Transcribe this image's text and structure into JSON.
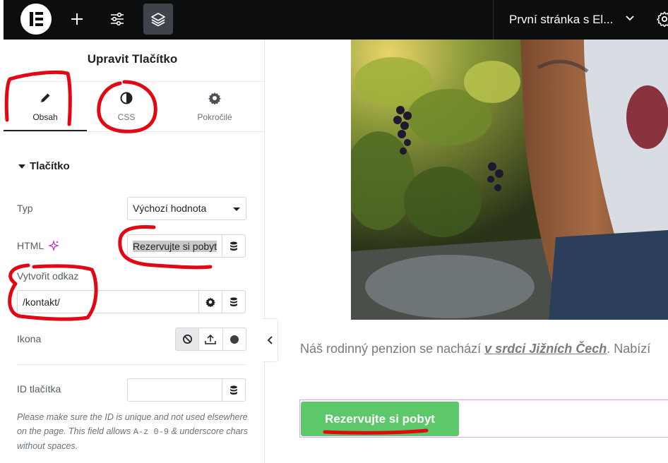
{
  "topbar": {
    "document_title": "První stránka s El...",
    "icons": [
      "elementor-logo-icon",
      "plus-icon",
      "sliders-icon",
      "layers-icon",
      "chevron-down-icon",
      "gear-icon"
    ]
  },
  "panel": {
    "title": "Upravit Tlačítko",
    "tabs": [
      {
        "label": "Obsah",
        "icon": "pencil-icon",
        "active": true
      },
      {
        "label": "CSS",
        "icon": "contrast-icon",
        "active": false
      },
      {
        "label": "Pokročilé",
        "icon": "gear-icon",
        "active": false
      }
    ],
    "section_title": "Tlačítko",
    "fields": {
      "type": {
        "label": "Typ",
        "value": "Výchozí hodnota"
      },
      "html": {
        "label": "HTML",
        "value": "Rezervujte si pobyt"
      },
      "link": {
        "label": "Vytvořit odkaz",
        "value": "/kontakt/"
      },
      "icon": {
        "label": "Ikona"
      },
      "button_id": {
        "label": "ID tlačítka",
        "value": ""
      }
    },
    "help": {
      "before": "Please make sure the ID is unique and not used elsewhere on the page. This field allows ",
      "code": "A-z 0-9",
      "after": " & underscore chars without spaces."
    }
  },
  "preview": {
    "paragraph": {
      "before": "Náš rodinný penzion se nachází ",
      "emphasis": "v srdci Jižních Čech",
      "after": ". Nabízí"
    },
    "button_label": "Rezervujte si pobyt"
  },
  "colors": {
    "topbar_bg": "#0c0d0e",
    "cta_bg": "#5cc86a",
    "annotation_red": "#e30613",
    "selection_outline": "#d9a6ee"
  }
}
